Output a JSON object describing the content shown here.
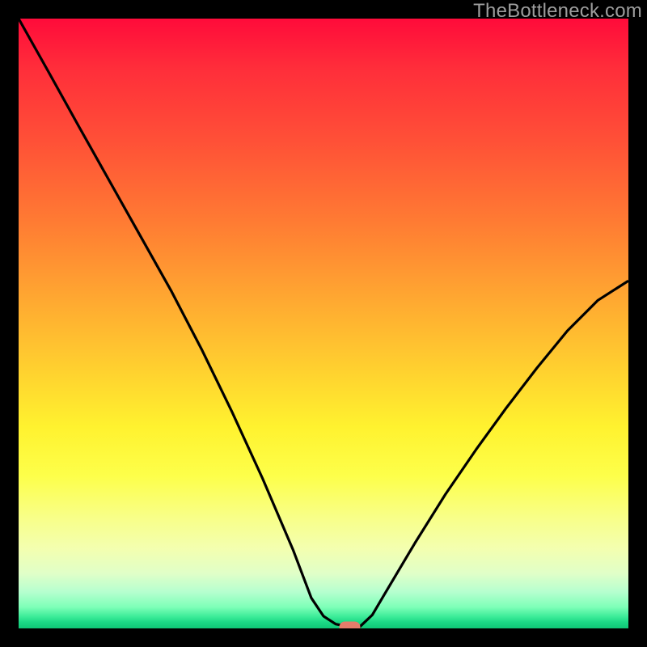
{
  "watermark": {
    "text": "TheBottleneck.com"
  },
  "colors": {
    "bg": "#000000",
    "gradient_stops": [
      "#ff0b3a",
      "#ff2d3a",
      "#ff5037",
      "#ff7a33",
      "#ffa831",
      "#ffd22f",
      "#fff22f",
      "#fdff4a",
      "#f8ff8a",
      "#f3ffb0",
      "#e0ffc8",
      "#b6ffcf",
      "#7effb8",
      "#3fed9a",
      "#1bd885",
      "#0fc776"
    ],
    "curve": "#000000",
    "marker": "#e57c6b"
  },
  "chart_data": {
    "type": "line",
    "title": "",
    "xlabel": "",
    "ylabel": "",
    "xlim": [
      0,
      100
    ],
    "ylim": [
      0,
      100
    ],
    "grid": false,
    "x": [
      0,
      5,
      10,
      15,
      20,
      25,
      30,
      35,
      40,
      45,
      48,
      50,
      52,
      54,
      56,
      58,
      60,
      65,
      70,
      75,
      80,
      85,
      90,
      95,
      100
    ],
    "values": [
      100,
      91.1,
      82.1,
      73.2,
      64.3,
      55.4,
      45.8,
      35.5,
      24.6,
      12.9,
      5.0,
      2.0,
      0.7,
      0.3,
      0.3,
      2.2,
      5.6,
      14.0,
      22.0,
      29.3,
      36.2,
      42.7,
      48.8,
      53.8,
      57.0
    ],
    "annotations": [
      {
        "kind": "marker",
        "shape": "pill",
        "x": 54,
        "y": 0.3
      }
    ]
  }
}
